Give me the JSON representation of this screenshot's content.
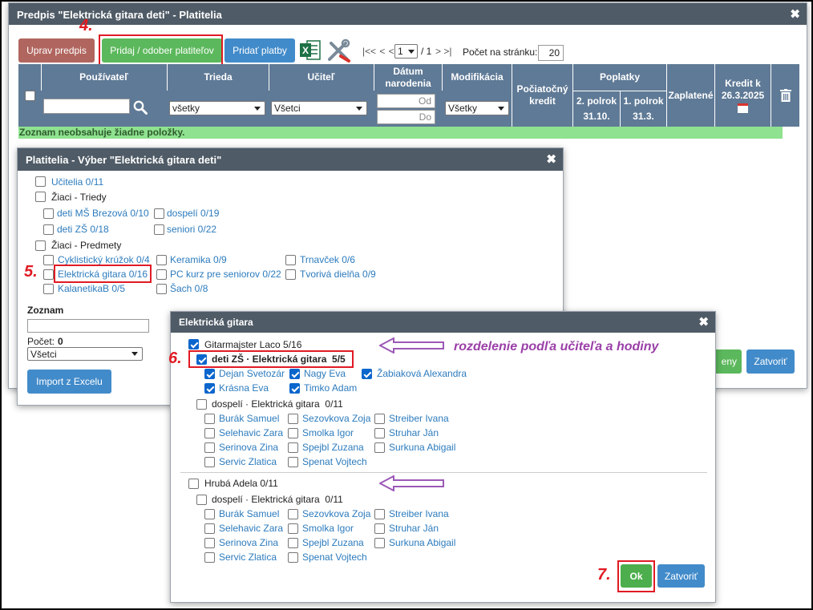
{
  "main": {
    "title": "Predpis \"Elektrická gitara deti\" - Platitelia",
    "buttons": {
      "uprav": "Uprav predpis",
      "pridaj": "Pridaj / odober platiteľov",
      "platby": "Pridať platby"
    },
    "pager": {
      "first": "|<",
      "prev3": "< < <",
      "page": "1",
      "of": "/ 1",
      "next": "> >|",
      "per_page_label": "Počet na stránku:",
      "per_page": "20"
    },
    "columns": {
      "user": "Používateľ",
      "class": "Trieda",
      "teacher": "Učiteľ",
      "birth": "Dátum narodenia",
      "mod": "Modifikácia",
      "initial": "Počiatočný kredit",
      "fees": "Poplatky",
      "h2": "2. polrok",
      "h1": "1. polrok",
      "d2": "31.10.",
      "d1": "31.3.",
      "paid": "Zaplatené",
      "credit": "Kredit k 26.3.2025"
    },
    "filters": {
      "class": "všetky",
      "teacher": "Všetci",
      "from": "Od",
      "to": "Do",
      "mod": "Všetky"
    },
    "empty_msg": "Zoznam neobsahuje žiadne položky.",
    "peek_btn": "eny",
    "close_btn": "Zatvoriť"
  },
  "payers": {
    "title": "Platitelia - Výber \"Elektrická gitara deti\"",
    "teachers": "Učitelia 0/11",
    "classes_group": "Žiaci - Triedy",
    "classes": [
      "deti MŠ Brezová 0/10",
      "dospelí 0/19",
      "deti ZŠ 0/18",
      "seniori 0/22"
    ],
    "subjects_group": "Žiaci - Predmety",
    "subjects": [
      "Cyklistický krúžok 0/4",
      "Keramika 0/9",
      "Trnavček 0/6",
      "Elektrická gitara 0/16",
      "PC kurz pre seniorov 0/22",
      "Tvorivá dielňa 0/9",
      "KalanetikaB 0/5",
      "Šach 0/8"
    ],
    "list_label": "Zoznam",
    "count_label": "Počet:",
    "count": "0",
    "count_select": "Všetci",
    "import_btn": "Import z Excelu"
  },
  "guitar": {
    "title": "Elektrická gitara",
    "teacher1": "Gitarmajster Laco 5/16",
    "annotation": "rozdelenie podľa učiteľa a hodiny",
    "group1": "deti ZŠ · Elektrická gitara  5/5",
    "group1_students": [
      "Dejan Svetozár",
      "Nagy Eva",
      "Žabiaková Alexandra",
      "Krásna Eva",
      "Timko Adam"
    ],
    "group2": "dospelí · Elektrická gitara  0/11",
    "adult_students": [
      "Burák Samuel",
      "Sezovkova Zoja",
      "Streiber Ivana",
      "Selehavic Zara",
      "Smolka Igor",
      "Struhar Ján",
      "Serinova Zina",
      "Spejbl Zuzana",
      "Surkuna Abigail",
      "Servic Zlatica",
      "Spenat Vojtech"
    ],
    "teacher2": "Hrubá Adela 0/11",
    "group3": "dospelí · Elektrická gitara  0/11",
    "ok": "Ok",
    "close": "Zatvoriť"
  },
  "steps": {
    "s4": "4.",
    "s5": "5.",
    "s6": "6.",
    "s7": "7."
  },
  "colors": {
    "accent_green": "#4cae4c",
    "header_blue": "#5f7a96",
    "title_gray": "#4f5b66",
    "button_blue": "#428bca",
    "annotation_purple": "#9b59b6",
    "highlight_red": "#e01b24"
  }
}
